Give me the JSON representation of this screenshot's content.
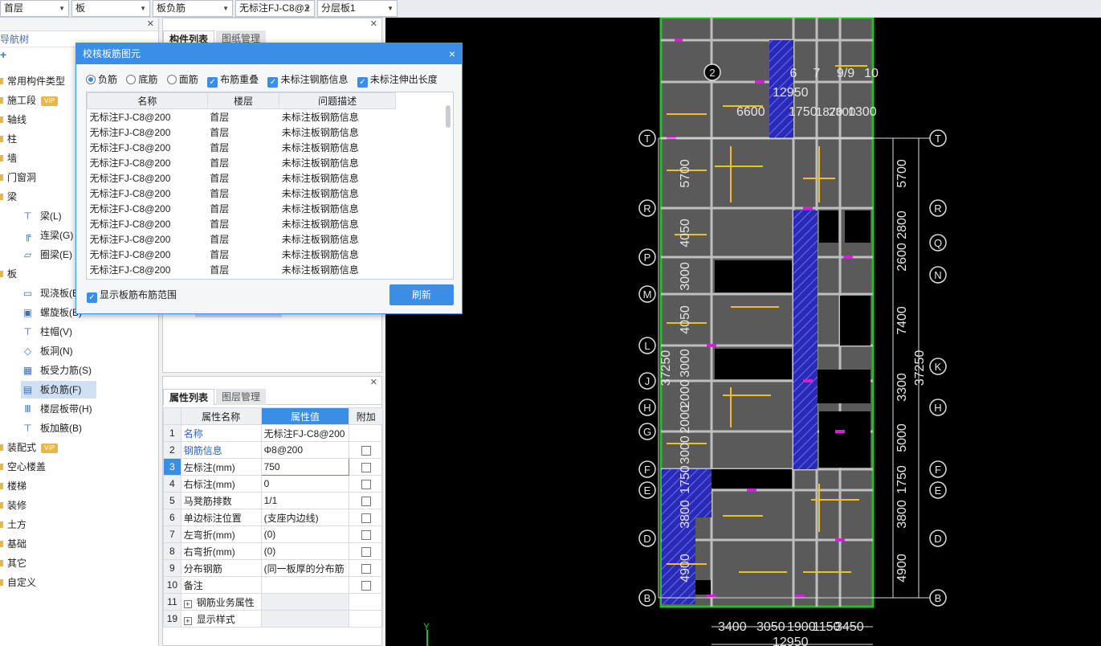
{
  "toolbar": {
    "floor_select": "首层",
    "category_select": "板",
    "type_select": "板负筋",
    "component_select": "无标注FJ-C8@2",
    "layer_select": "分层板1"
  },
  "nav": {
    "title": "导航树",
    "add": "+",
    "items": [
      {
        "label": "常用构件类型"
      },
      {
        "label": "施工段",
        "badge": "VIP"
      },
      {
        "label": "轴线"
      },
      {
        "label": "柱"
      },
      {
        "label": "墙"
      },
      {
        "label": "门窗洞"
      },
      {
        "label": "梁"
      },
      {
        "label": "板"
      },
      {
        "label": "装配式",
        "badge": "VIP"
      },
      {
        "label": "空心楼盖"
      },
      {
        "label": "楼梯"
      },
      {
        "label": "装修"
      },
      {
        "label": "土方"
      },
      {
        "label": "基础"
      },
      {
        "label": "其它"
      },
      {
        "label": "自定义"
      }
    ],
    "beam_children": [
      "梁(L)",
      "连梁(G)",
      "圈梁(E)"
    ],
    "slab_children": [
      "现浇板(B)",
      "螺旋板(B)",
      "柱帽(V)",
      "板洞(N)",
      "板受力筋(S)",
      "板负筋(F)",
      "楼层板带(H)",
      "板加腋(B)"
    ]
  },
  "component_panel": {
    "tabs": [
      "构件列表",
      "图纸管理"
    ]
  },
  "property_panel": {
    "tabs": [
      "属性列表",
      "图层管理"
    ],
    "headers": [
      "属性名称",
      "属性值",
      "附加"
    ],
    "rows": [
      {
        "num": "1",
        "name": "名称",
        "value": "无标注FJ-C8@200",
        "check": false
      },
      {
        "num": "2",
        "name": "钢筋信息",
        "value": "Φ8@200",
        "check": true
      },
      {
        "num": "3",
        "name": "左标注(mm)",
        "value": "750",
        "check": true
      },
      {
        "num": "4",
        "name": "右标注(mm)",
        "value": "0",
        "check": true
      },
      {
        "num": "5",
        "name": "马凳筋排数",
        "value": "1/1",
        "check": true
      },
      {
        "num": "6",
        "name": "单边标注位置",
        "value": "(支座内边线)",
        "check": true
      },
      {
        "num": "7",
        "name": "左弯折(mm)",
        "value": "(0)",
        "check": true
      },
      {
        "num": "8",
        "name": "右弯折(mm)",
        "value": "(0)",
        "check": true
      },
      {
        "num": "9",
        "name": "分布钢筋",
        "value": "(同一板厚的分布筋",
        "check": true
      },
      {
        "num": "10",
        "name": "备注",
        "value": "",
        "check": true
      },
      {
        "num": "11",
        "name": "钢筋业务属性",
        "value": "",
        "check": false,
        "group": true
      },
      {
        "num": "19",
        "name": "显示样式",
        "value": "",
        "check": false,
        "group": true
      }
    ]
  },
  "dialog": {
    "title": "校核板筋图元",
    "close": "×",
    "radios": [
      "负筋",
      "底筋",
      "面筋"
    ],
    "checks": [
      "布筋重叠",
      "未标注钢筋信息",
      "未标注伸出长度"
    ],
    "headers": [
      "名称",
      "楼层",
      "问题描述"
    ],
    "rows": [
      [
        "无标注FJ-C8@200",
        "首层",
        "未标注板钢筋信息"
      ],
      [
        "无标注FJ-C8@200",
        "首层",
        "未标注板钢筋信息"
      ],
      [
        "无标注FJ-C8@200",
        "首层",
        "未标注板钢筋信息"
      ],
      [
        "无标注FJ-C8@200",
        "首层",
        "未标注板钢筋信息"
      ],
      [
        "无标注FJ-C8@200",
        "首层",
        "未标注板钢筋信息"
      ],
      [
        "无标注FJ-C8@200",
        "首层",
        "未标注板钢筋信息"
      ],
      [
        "无标注FJ-C8@200",
        "首层",
        "未标注板钢筋信息"
      ],
      [
        "无标注FJ-C8@200",
        "首层",
        "未标注板钢筋信息"
      ],
      [
        "无标注FJ-C8@200",
        "首层",
        "未标注板钢筋信息"
      ],
      [
        "无标注FJ-C8@200",
        "首层",
        "未标注板钢筋信息"
      ],
      [
        "无标注FJ-C8@200",
        "首层",
        "未标注板钢筋信息"
      ]
    ],
    "show_range": "显示板筋布筋范围",
    "refresh": "刷新"
  },
  "cad": {
    "top_axes": [
      "2",
      "6",
      "7",
      "9/9",
      "10"
    ],
    "top_dims": [
      "12950",
      "6600",
      "1750",
      "1870",
      "2300",
      "1300"
    ],
    "rows_left": [
      "T",
      "R",
      "P",
      "M",
      "L",
      "J",
      "H",
      "G",
      "F",
      "E",
      "D",
      "B"
    ],
    "rows_right": [
      "T",
      "R",
      "Q",
      "N",
      "K",
      "H",
      "F",
      "E",
      "D",
      "B"
    ],
    "left_dims": [
      "5700",
      "4050",
      "3000",
      "4050",
      "3000",
      "2000",
      "2000",
      "3000",
      "1750",
      "3800",
      "4900"
    ],
    "left_total": "37250",
    "right_dims": [
      "5700",
      "2800",
      "2600",
      "7400",
      "3300",
      "5000",
      "1750",
      "3800",
      "4900"
    ],
    "right_total": "37250",
    "bottom_dims": [
      "3400",
      "3050",
      "1900",
      "1150",
      "3450"
    ],
    "bottom_total": "12950",
    "y_axis": "Y"
  }
}
